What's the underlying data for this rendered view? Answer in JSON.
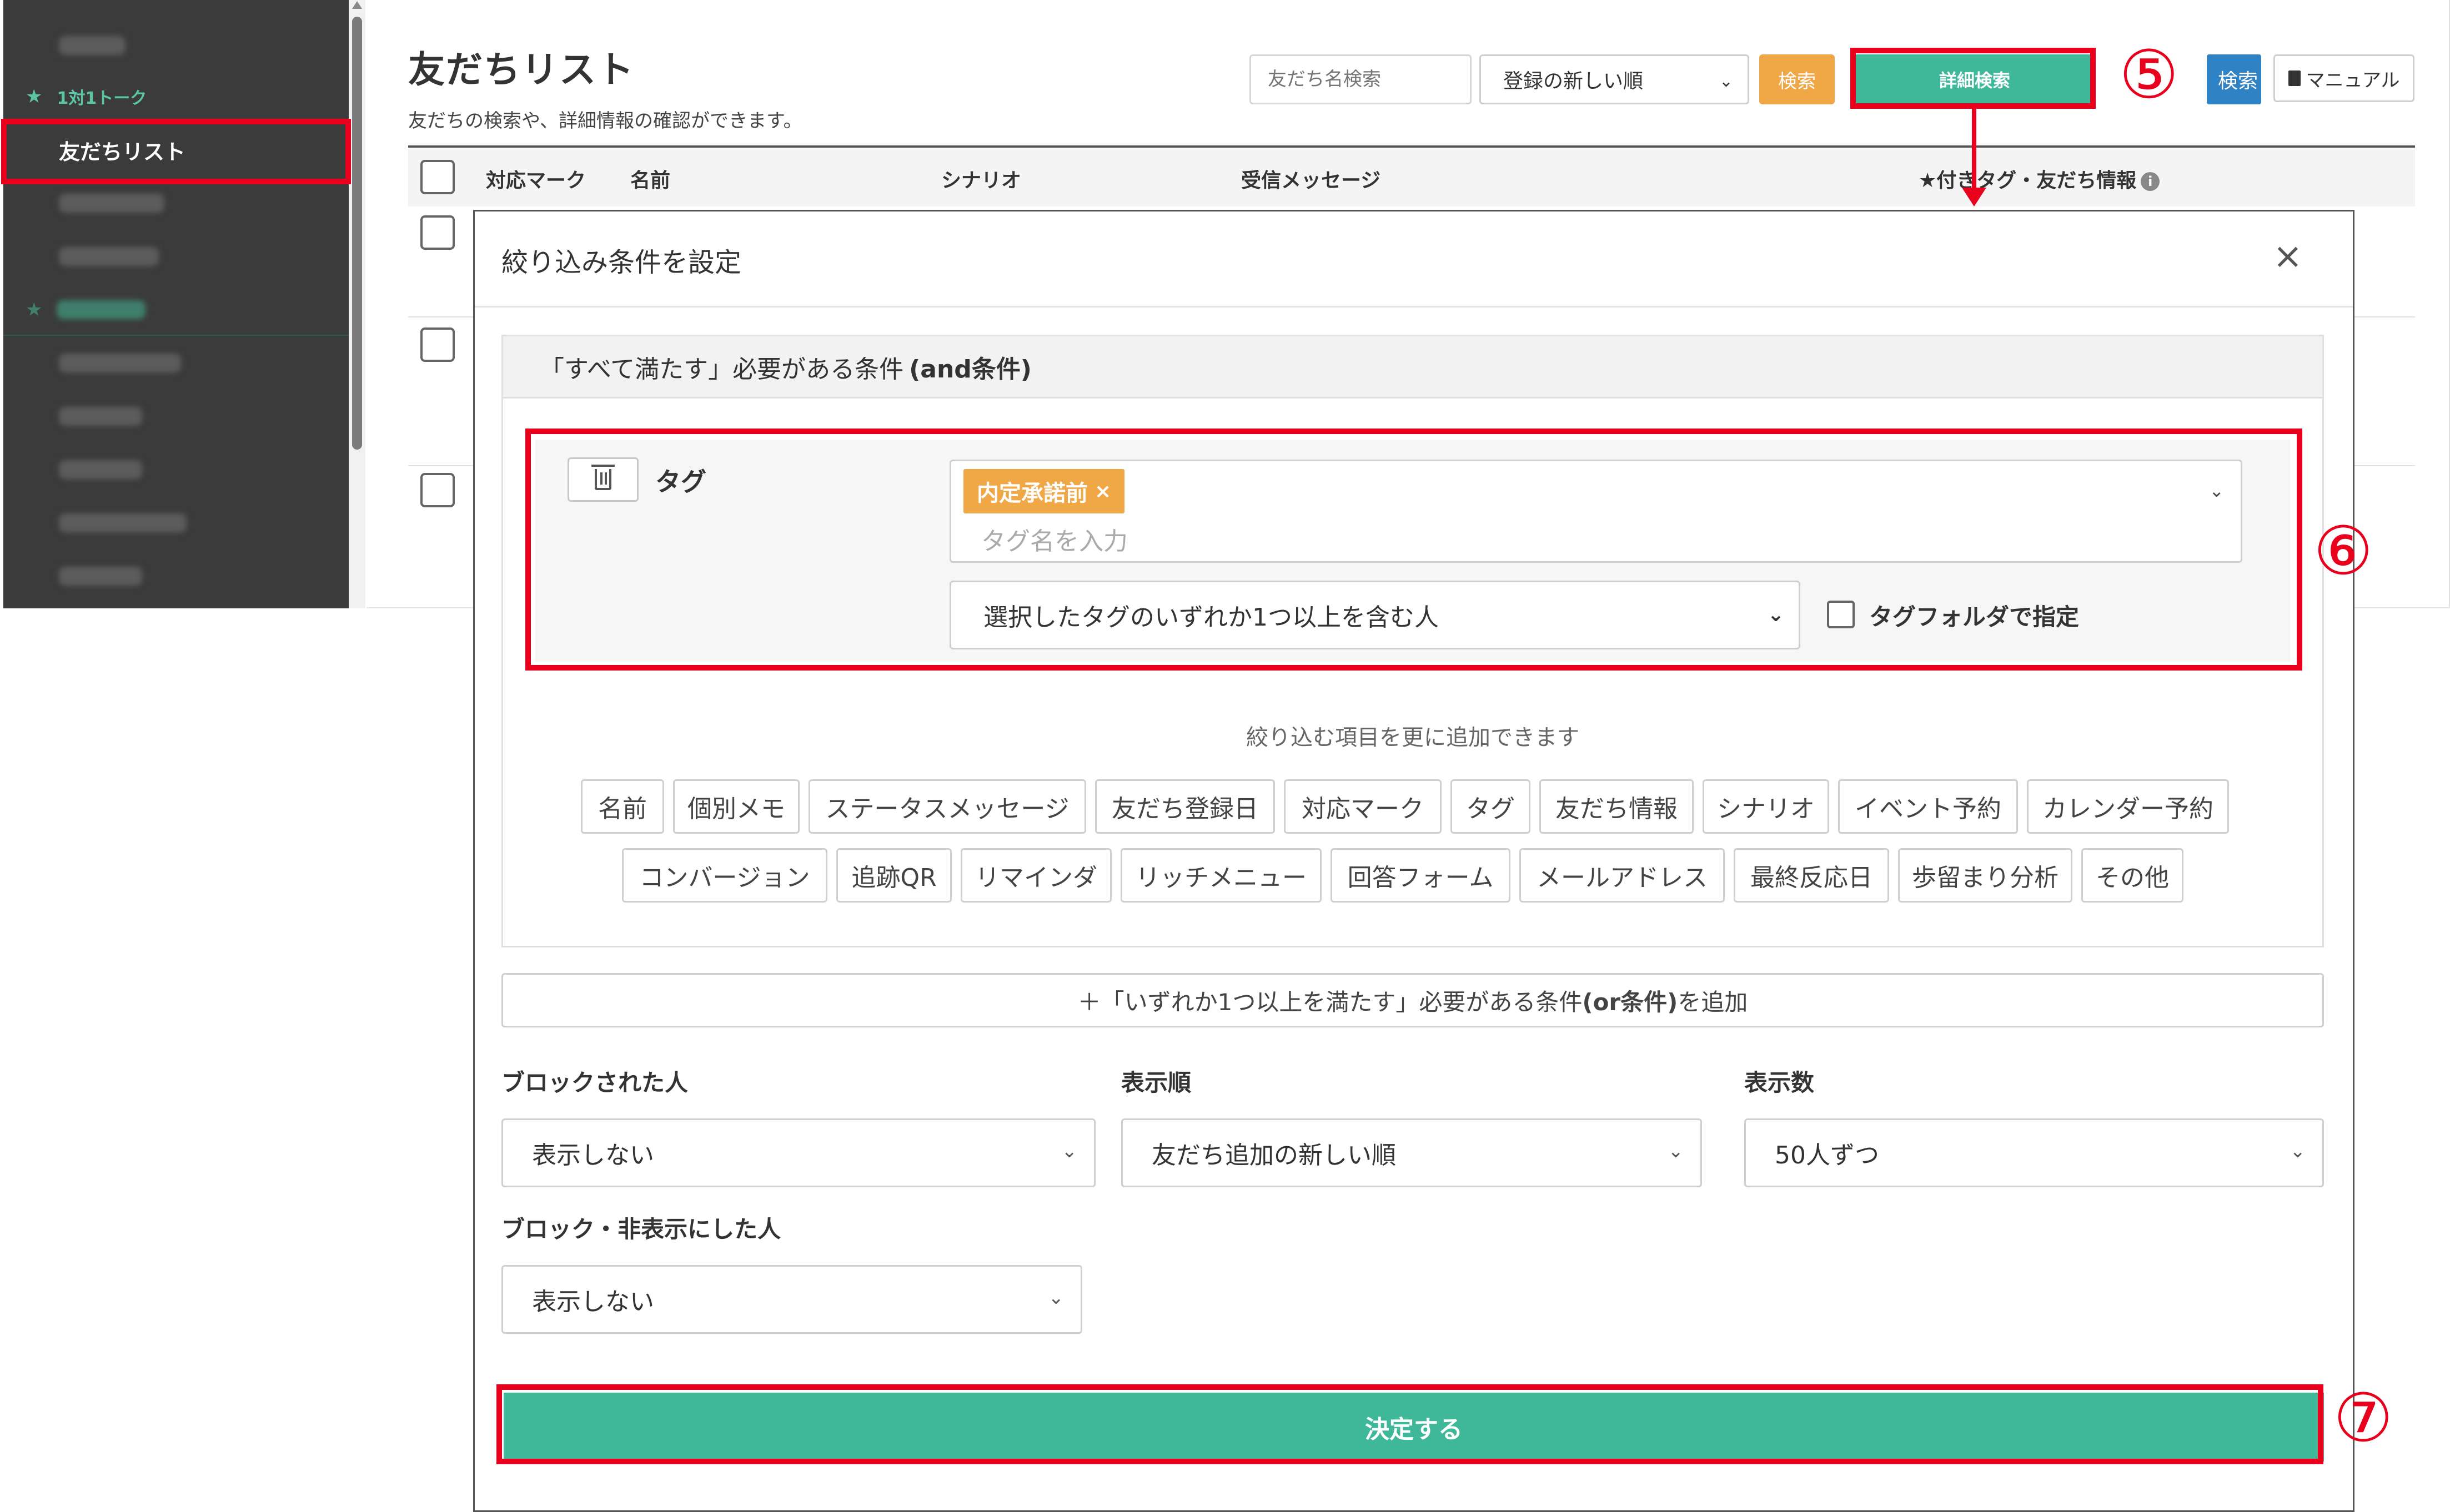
{
  "sidebar": {
    "section_1on1": "1対1トーク",
    "active_item": "友だちリスト"
  },
  "page": {
    "title": "友だちリスト",
    "subtitle": "友だちの検索や、詳細情報の確認ができます。"
  },
  "toolbar": {
    "search_placeholder": "友だち名検索",
    "sort_value": "登録の新しい順",
    "search_label": "検索",
    "detail_search_label": "詳細検索",
    "search2_label": "検索",
    "manual_label": "マニュアル"
  },
  "table": {
    "headers": [
      "対応マーク",
      "名前",
      "シナリオ",
      "受信メッセージ",
      "★付きタグ・友だち情報"
    ]
  },
  "annotations": {
    "step5": "⑤",
    "step6": "⑥",
    "step7": "⑦"
  },
  "modal": {
    "title": "絞り込み条件を設定",
    "close": "×",
    "and_header_prefix": "「すべて満たす」必要がある条件",
    "and_header_bold": "(and条件)",
    "tag_condition": {
      "label": "タグ",
      "selected_tag": "内定承諾前",
      "chip_remove": "×",
      "placeholder": "タグ名を入力",
      "mode_value": "選択したタグのいずれか1つ以上を含む人",
      "folder_label": "タグフォルダで指定"
    },
    "add_hint": "絞り込む項目を更に追加できます",
    "filter_items_row1": [
      "名前",
      "個別メモ",
      "ステータスメッセージ",
      "友だち登録日",
      "対応マーク",
      "タグ",
      "友だち情報",
      "シナリオ",
      "イベント予約",
      "カレンダー予約"
    ],
    "filter_items_row2": [
      "コンバージョン",
      "追跡QR",
      "リマインダ",
      "リッチメニュー",
      "回答フォーム",
      "メールアドレス",
      "最終反応日",
      "歩留まり分析",
      "その他"
    ],
    "or_button_prefix": "＋「いずれか1つ以上を満たす」必要がある条件",
    "or_button_bold": "(or条件)",
    "or_button_suffix": "を追加",
    "blocked_label": "ブロックされた人",
    "blocked_value": "表示しない",
    "order_label": "表示順",
    "order_value": "友だち追加の新しい順",
    "count_label": "表示数",
    "count_value": "50人ずつ",
    "hidden_label": "ブロック・非表示にした人",
    "hidden_value": "表示しない",
    "submit_label": "決定する"
  },
  "colors": {
    "accent_green": "#3fb89a",
    "tag_orange": "#f0a846",
    "annotation_red": "#e8001c"
  }
}
